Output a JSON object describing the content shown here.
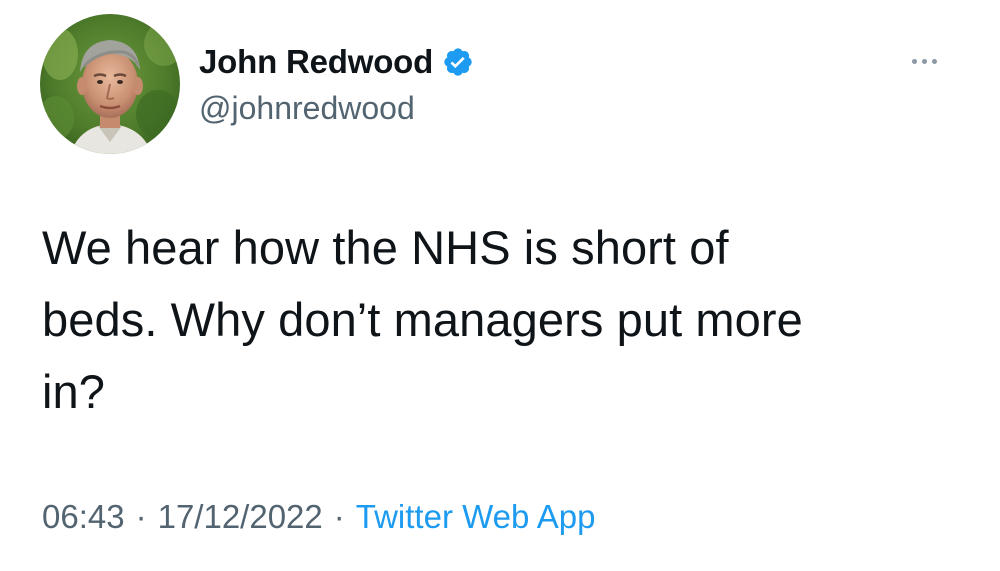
{
  "author": {
    "display_name": "John Redwood",
    "handle": "@johnredwood",
    "verified": true,
    "verified_icon": "verified-badge-icon",
    "avatar": "profile-photo"
  },
  "tweet": {
    "text": "We hear how the NHS is short of\nbeds. Why don’t managers put more\nin?",
    "time": "06:43",
    "date": "17/12/2022",
    "separator": "·",
    "source": "Twitter Web App"
  },
  "menu": {
    "icon": "more-options-icon"
  },
  "colors": {
    "text_primary": "#0f1419",
    "text_secondary": "#536471",
    "accent": "#1d9bf0",
    "background": "#ffffff"
  }
}
